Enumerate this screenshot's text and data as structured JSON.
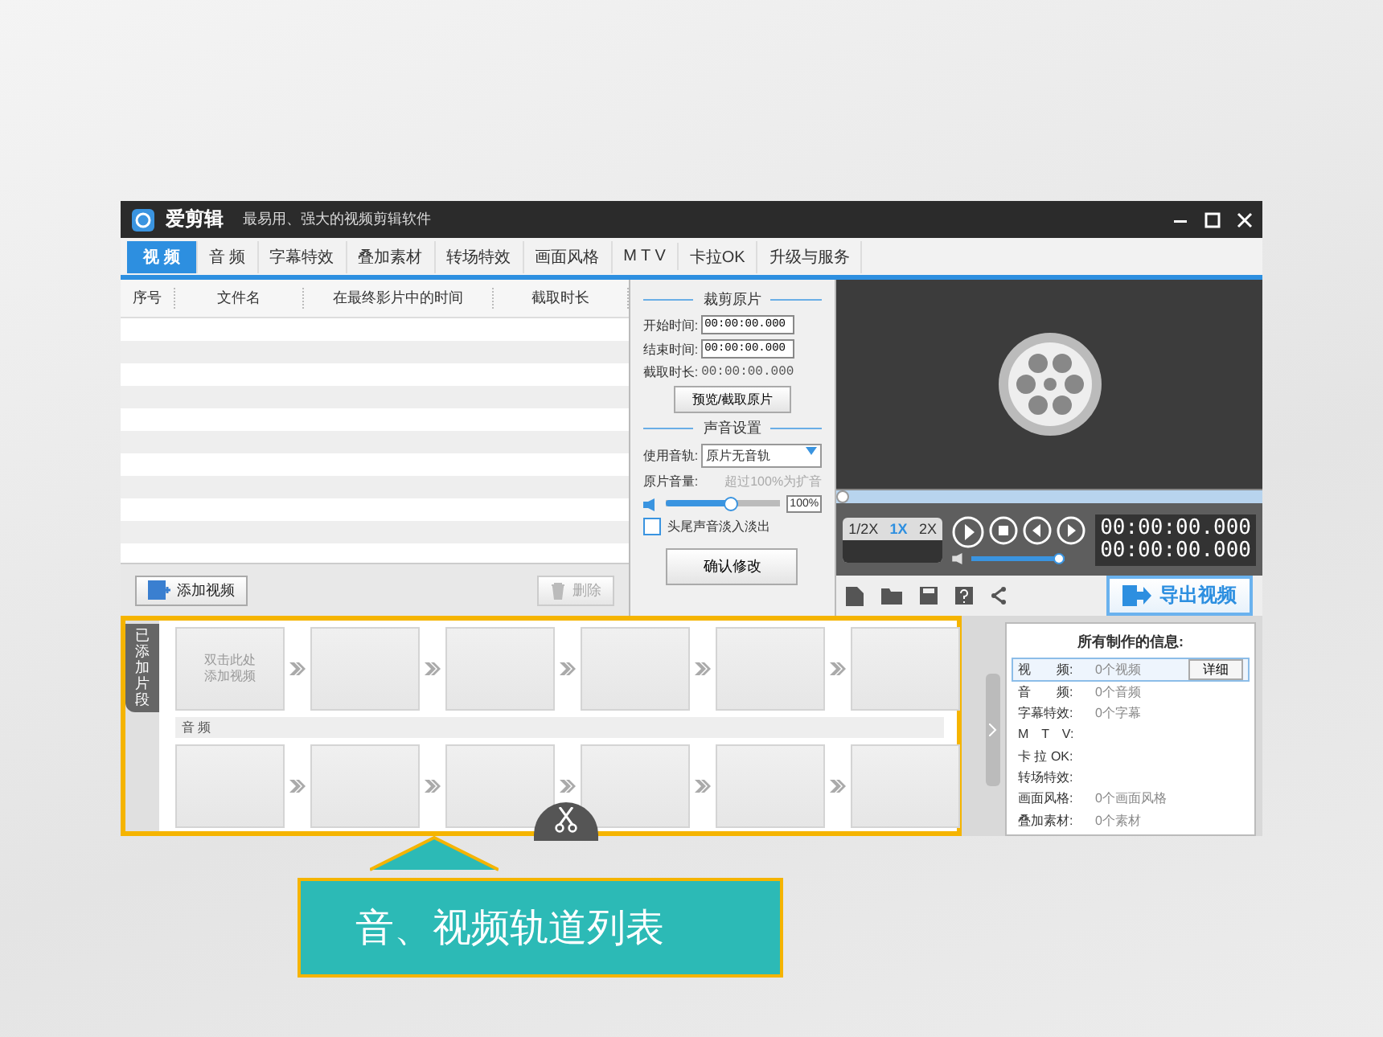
{
  "window": {
    "title": "爱剪辑",
    "subtitle": "最易用、强大的视频剪辑软件"
  },
  "tabs": [
    {
      "label": "视 频",
      "selected": true
    },
    {
      "label": "音 频",
      "selected": false
    },
    {
      "label": "字幕特效",
      "selected": false
    },
    {
      "label": "叠加素材",
      "selected": false
    },
    {
      "label": "转场特效",
      "selected": false
    },
    {
      "label": "画面风格",
      "selected": false
    },
    {
      "label": "M T V",
      "selected": false
    },
    {
      "label": "卡拉OK",
      "selected": false
    },
    {
      "label": "升级与服务",
      "selected": false
    }
  ],
  "clip_list": {
    "columns": [
      "序号",
      "文件名",
      "在最终影片中的时间",
      "截取时长"
    ],
    "add_button": "添加视频",
    "delete_button": {
      "label": "删除",
      "disabled": true
    }
  },
  "trim_panel": {
    "title": "裁剪原片",
    "fields": [
      {
        "label": "开始时间:",
        "value": "00:00:00.000"
      },
      {
        "label": "结束时间:",
        "value": "00:00:00.000"
      }
    ],
    "duration": {
      "label": "截取时长:",
      "value": "00:00:00.000"
    },
    "preview_button": "预览/截取原片",
    "sound_title": "声音设置",
    "track": {
      "label": "使用音轨:",
      "value": "原片无音轨"
    },
    "volume": {
      "label": "原片音量:",
      "hint": "超过100%为扩音",
      "level": 0.58,
      "reading": "100%"
    },
    "fade": {
      "label": "头尾声音淡入淡出",
      "checked": false
    },
    "confirm_button": "确认修改"
  },
  "player": {
    "progress": {
      "level": 0
    },
    "speeds": [
      {
        "label": "1/2X",
        "selected": false
      },
      {
        "label": "1X",
        "selected": true
      },
      {
        "label": "2X",
        "selected": false
      }
    ],
    "times": [
      "00:00:00.000",
      "00:00:00.000"
    ],
    "volume": {
      "level": 1
    },
    "export_button": "导出视频"
  },
  "timeline": {
    "side_label": "已添加片段",
    "placeholder": [
      "双击此处",
      "添加视频"
    ],
    "audio_label": "音 频"
  },
  "info_panel": {
    "title": "所有制作的信息:",
    "detail_button": "详细",
    "rows": [
      {
        "label": "视　　频:",
        "value": "0个视频",
        "selected": true
      },
      {
        "label": "音　　频:",
        "value": "0个音频",
        "selected": false
      },
      {
        "label": "字幕特效:",
        "value": "0个字幕",
        "selected": false
      },
      {
        "label": "M　T　V:",
        "selected": false
      },
      {
        "label": "卡 拉 OK:",
        "selected": false
      },
      {
        "label": "转场特效:",
        "selected": false
      },
      {
        "label": "画面风格:",
        "value": "0个画面风格",
        "selected": false
      },
      {
        "label": "叠加素材:",
        "value": "0个素材",
        "selected": false
      }
    ]
  },
  "callout": {
    "text": "音、视频轨道列表"
  }
}
